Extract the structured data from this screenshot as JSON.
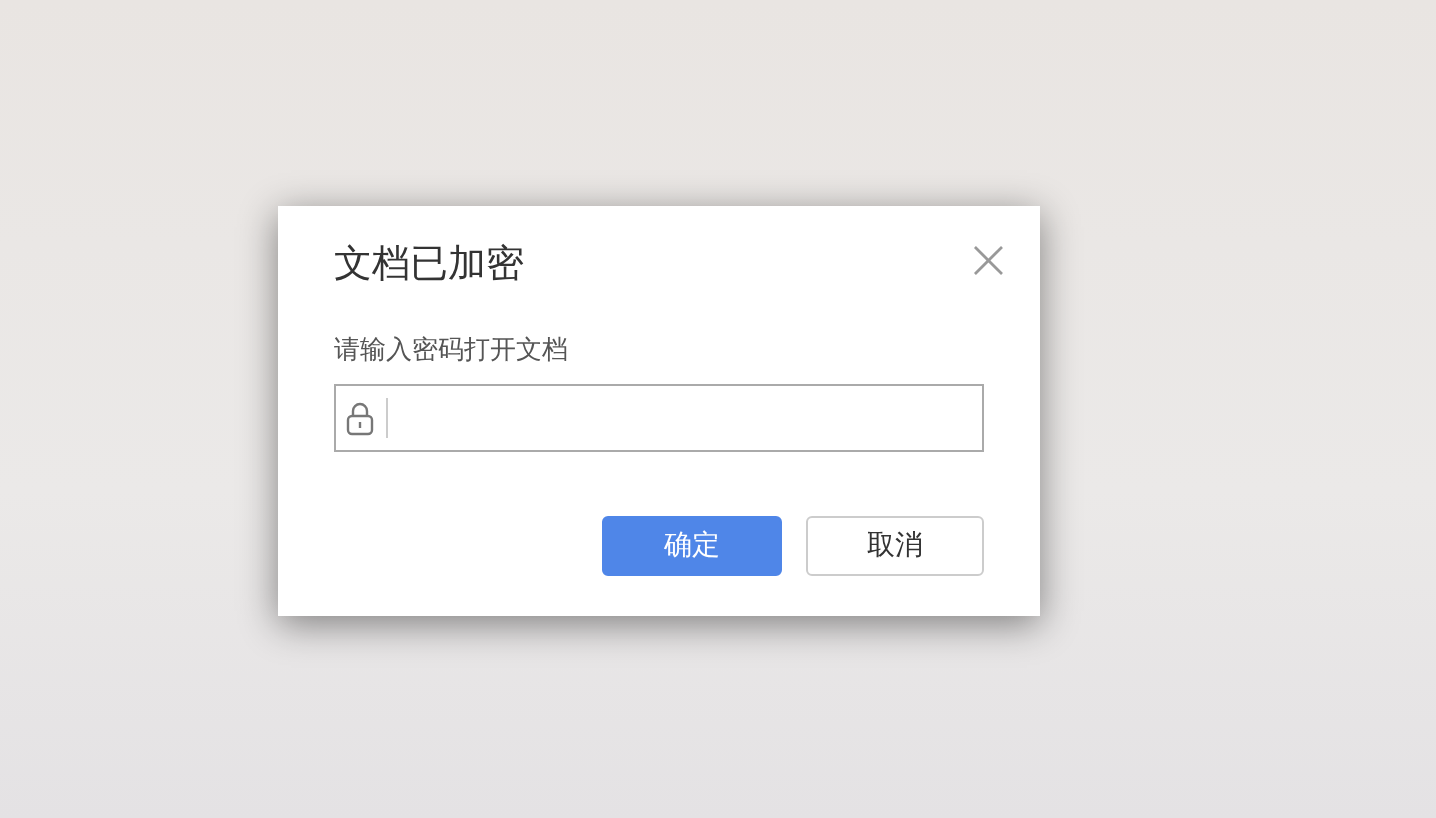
{
  "dialog": {
    "title": "文档已加密",
    "close": "×",
    "prompt": "请输入密码打开文档",
    "buttons": [
      {
        "label": "确定",
        "kind": "primary"
      },
      {
        "label": "取消",
        "kind": "secondary"
      }
    ]
  }
}
